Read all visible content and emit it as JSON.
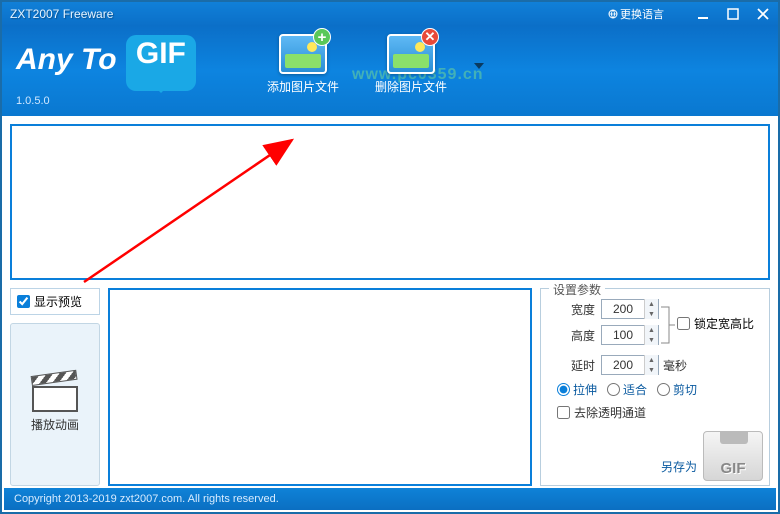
{
  "window": {
    "title": "ZXT2007 Freeware"
  },
  "titlebar": {
    "lang_switch": "更换语言"
  },
  "brand": {
    "any": "Any To",
    "gif": "GIF",
    "version": "1.0.5.0"
  },
  "watermark": "www.pc0359.cn",
  "toolbar": {
    "add": "添加图片文件",
    "del": "删除图片文件"
  },
  "preview": {
    "show": "显示预览",
    "play": "播放动画"
  },
  "params": {
    "legend": "设置参数",
    "width_label": "宽度",
    "width_value": "200",
    "height_label": "高度",
    "height_value": "100",
    "lock_ar": "锁定宽高比",
    "delay_label": "延时",
    "delay_value": "200",
    "delay_unit": "毫秒",
    "fit": {
      "stretch": "拉伸",
      "fit": "适合",
      "crop": "剪切"
    },
    "remove_alpha": "去除透明通道",
    "saveas": "另存为",
    "saveas_badge": "GIF"
  },
  "status": "Copyright 2013-2019 zxt2007.com. All rights reserved."
}
